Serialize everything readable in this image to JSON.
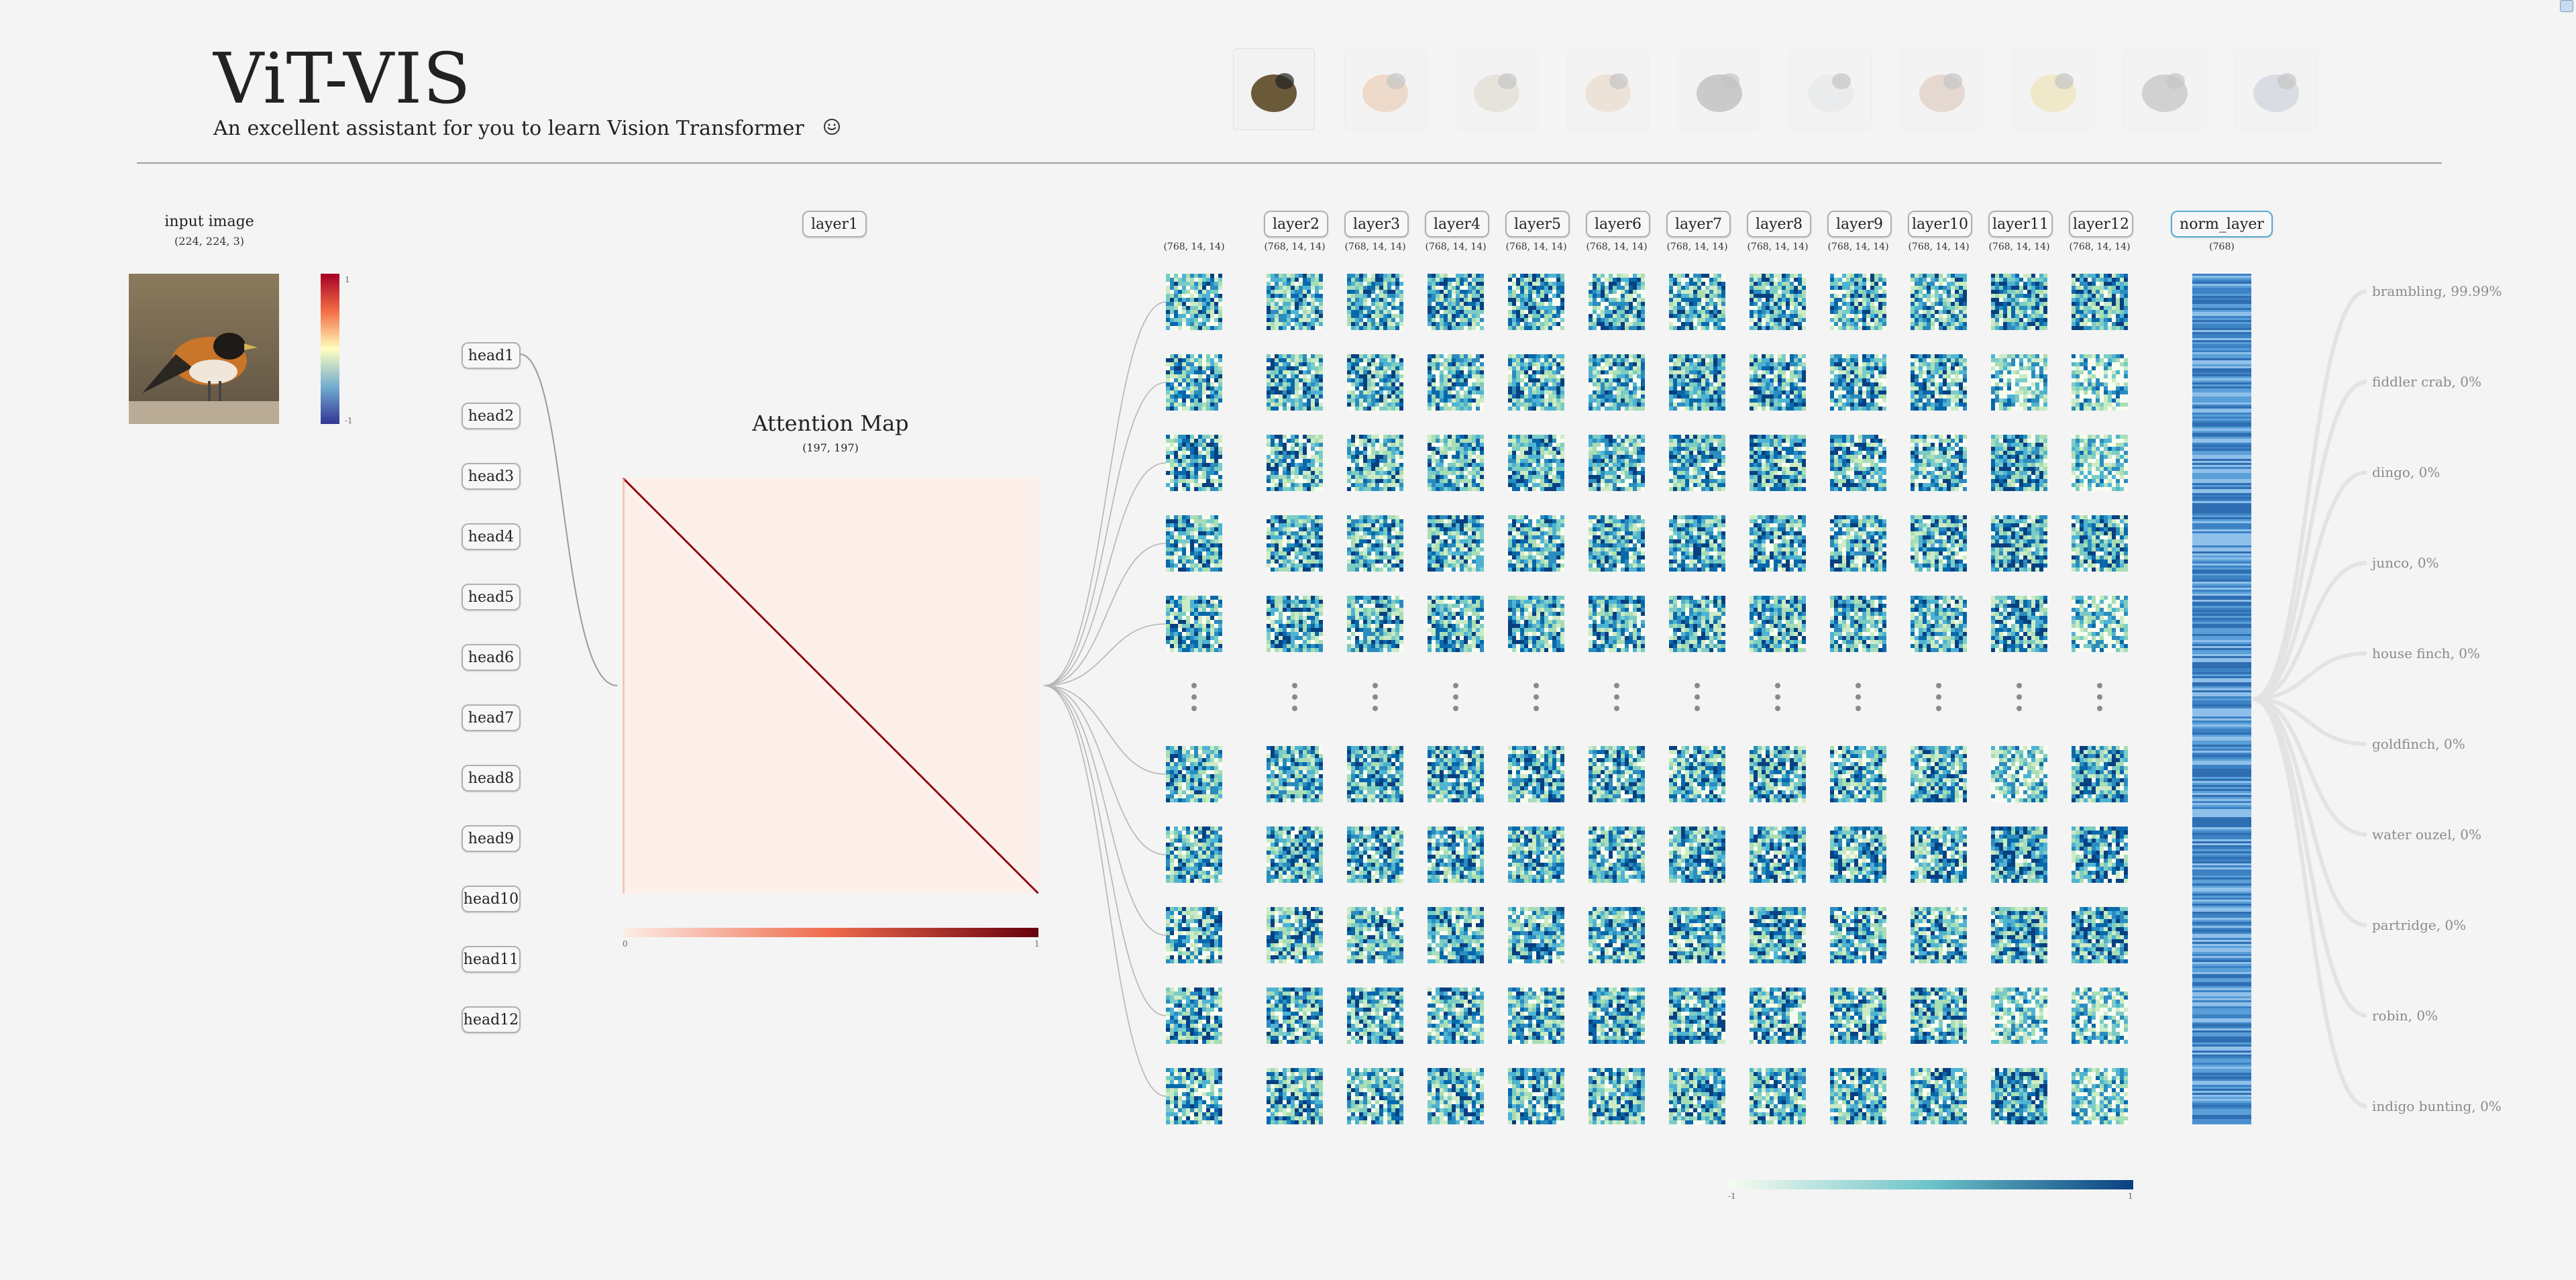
{
  "header": {
    "title": "ViT-VIS",
    "subtitle": "An excellent assistant for you to learn Vision Transformer",
    "smile_icon": "smile-icon",
    "gallery": [
      {
        "name": "bird-thumbnail",
        "selected": true,
        "color": "#6b5a3a"
      },
      {
        "name": "sports-car-thumbnail",
        "selected": false,
        "color": "#d9823a"
      },
      {
        "name": "cat-thumbnail",
        "selected": false,
        "color": "#b9a88f"
      },
      {
        "name": "chair-thumbnail",
        "selected": false,
        "color": "#d8a47a"
      },
      {
        "name": "horse-dark-thumbnail",
        "selected": false,
        "color": "#3b3b3b"
      },
      {
        "name": "white-dog-thumbnail",
        "selected": false,
        "color": "#c8ccd2"
      },
      {
        "name": "horse-snow-thumbnail",
        "selected": false,
        "color": "#b57a55"
      },
      {
        "name": "lemon-thumbnail",
        "selected": false,
        "color": "#e2c33a"
      },
      {
        "name": "panda-thumbnail",
        "selected": false,
        "color": "#5a5a5a"
      },
      {
        "name": "plane-thumbnail",
        "selected": false,
        "color": "#7c8ea8"
      }
    ]
  },
  "input": {
    "label": "input image",
    "shape": "(224, 224, 3)"
  },
  "input_scale": {
    "max": "1",
    "min": "-1"
  },
  "heads": [
    "head1",
    "head2",
    "head3",
    "head4",
    "head5",
    "head6",
    "head7",
    "head8",
    "head9",
    "head10",
    "head11",
    "head12"
  ],
  "layers": {
    "labels": [
      "layer1",
      "layer2",
      "layer3",
      "layer4",
      "layer5",
      "layer6",
      "layer7",
      "layer8",
      "layer9",
      "layer10",
      "layer11",
      "layer12"
    ],
    "shape": "(768, 14, 14)",
    "norm_label": "norm_layer",
    "norm_shape": "(768)"
  },
  "attention": {
    "title": "Attention Map",
    "shape": "(197, 197)",
    "scale_min": "0",
    "scale_max": "1"
  },
  "feature_scale": {
    "min": "-1",
    "max": "1"
  },
  "predictions": [
    {
      "label": "brambling, 99.99%"
    },
    {
      "label": "fiddler crab, 0%"
    },
    {
      "label": "dingo, 0%"
    },
    {
      "label": "junco, 0%"
    },
    {
      "label": "house finch, 0%"
    },
    {
      "label": "goldfinch, 0%"
    },
    {
      "label": "water ouzel, 0%"
    },
    {
      "label": "partridge, 0%"
    },
    {
      "label": "robin, 0%"
    },
    {
      "label": "indigo bunting, 0%"
    }
  ],
  "colors": {
    "attention_low": "#fdeee8",
    "attention_high": "#67000d",
    "feature_low": "#f7fcf0",
    "feature_mid": "#6cc3c9",
    "feature_high": "#084081",
    "accent": "#5aa9d6"
  }
}
